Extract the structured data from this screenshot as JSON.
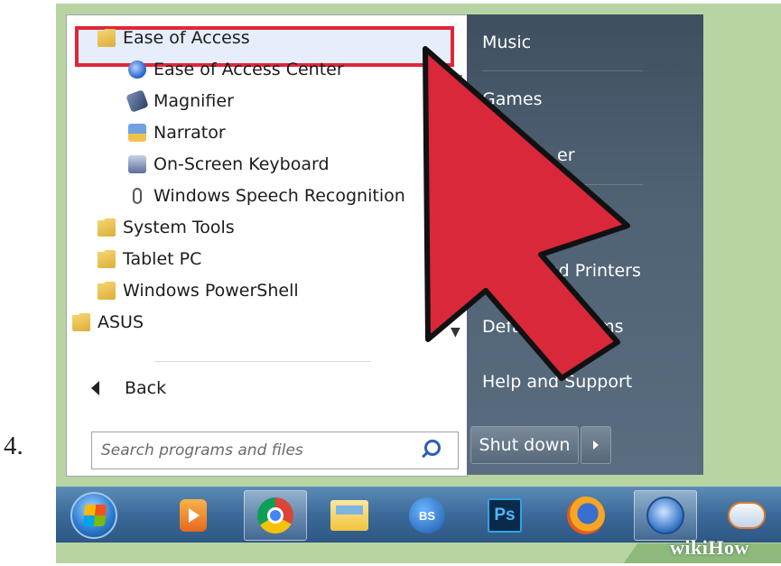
{
  "step": {
    "number": "4."
  },
  "programs": {
    "items": [
      {
        "label": "Ease of Access",
        "icon": "folder-icon",
        "indent": 1,
        "selected": true
      },
      {
        "label": "Ease of Access Center",
        "icon": "ease-of-access-center-icon",
        "indent": 2
      },
      {
        "label": "Magnifier",
        "icon": "magnifier-icon",
        "indent": 2
      },
      {
        "label": "Narrator",
        "icon": "narrator-icon",
        "indent": 2
      },
      {
        "label": "On-Screen Keyboard",
        "icon": "keyboard-icon",
        "indent": 2
      },
      {
        "label": "Windows Speech Recognition",
        "icon": "microphone-icon",
        "indent": 2
      },
      {
        "label": "System Tools",
        "icon": "folder-icon",
        "indent": 1
      },
      {
        "label": "Tablet PC",
        "icon": "folder-icon",
        "indent": 1
      },
      {
        "label": "Windows PowerShell",
        "icon": "folder-icon",
        "indent": 1
      },
      {
        "label": "ASUS",
        "icon": "folder-icon",
        "indent": 0
      }
    ],
    "back_label": "Back"
  },
  "search": {
    "placeholder": "Search programs and files"
  },
  "right_pane": {
    "links": [
      {
        "label": "Music",
        "visible_text": "Music"
      },
      {
        "label": "Games",
        "visible_text": "Games"
      },
      {
        "label": "",
        "visible_text": "er"
      },
      {
        "label": "Devices and Printers",
        "visible_text": "nd Printers"
      },
      {
        "label": "Default Programs",
        "visible_text": "rams"
      },
      {
        "label": "Help and Support",
        "visible_text": "Help and Support"
      }
    ],
    "partial": {
      "devices_prefix": "D",
      "default_prefix": "Defa"
    },
    "shutdown_label": "Shut down"
  },
  "taskbar": {
    "items": [
      {
        "icon": "start-orb-icon"
      },
      {
        "icon": "media-player-icon"
      },
      {
        "icon": "chrome-icon",
        "active": true
      },
      {
        "icon": "file-explorer-icon"
      },
      {
        "icon": "bluestacks-icon",
        "label": "BS"
      },
      {
        "icon": "photoshop-icon",
        "label": "Ps"
      },
      {
        "icon": "firefox-icon"
      },
      {
        "icon": "thunderbird-icon",
        "active": true
      },
      {
        "icon": "weather-icon"
      }
    ]
  },
  "colors": {
    "highlight_border": "#e0263b",
    "arrow_fill": "#d9283a",
    "background": "#b7d4a2",
    "right_pane": "#4f6274"
  },
  "watermark": "wikiHow"
}
